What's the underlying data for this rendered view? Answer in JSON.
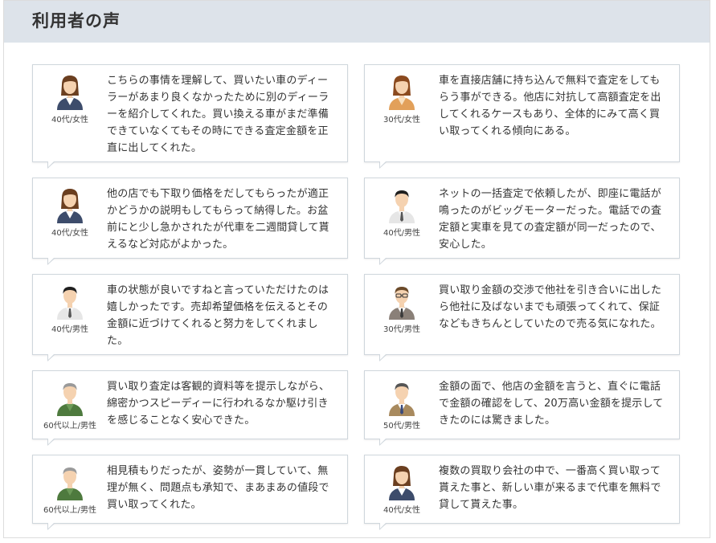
{
  "section": {
    "title": "利用者の声"
  },
  "testimonials": [
    {
      "age": "40代/女性",
      "avatar": "woman-business",
      "text": "こちらの事情を理解して、買いたい車のディーラーがあまり良くなかったために別のディーラーを紹介してくれた。買い換える車がまだ準備できていなくてもその時にできる査定金額を正直に出してくれた。"
    },
    {
      "age": "30代/女性",
      "avatar": "woman-orange",
      "text": "車を直接店舗に持ち込んで無料で査定をしてもらう事ができる。他店に対抗して高額査定を出してくれるケースもあり、全体的にみて高く買い取ってくれる傾向にある。"
    },
    {
      "age": "40代/女性",
      "avatar": "woman-business",
      "text": "他の店でも下取り価格をだしてもらったが適正かどうかの説明もしてもらって納得した。お盆前にと少し急かされたが代車を二週間貸して貰えるなど対応がよかった。"
    },
    {
      "age": "40代/男性",
      "avatar": "man-shirt",
      "text": "ネットの一括査定で依頼したが、即座に電話が鳴ったのがビッグモーターだった。電話での査定額と実車を見ての査定額が同一だったので、安心した。"
    },
    {
      "age": "40代/男性",
      "avatar": "man-shirt",
      "text": "車の状態が良いですねと言っていただけたのは嬉しかったです。売却希望価格を伝えるとその金額に近づけてくれると努力をしてくれました。"
    },
    {
      "age": "30代/男性",
      "avatar": "man-glasses",
      "text": "買い取り金額の交渉で他社を引き合いに出したら他社に及ばないまでも頑張ってくれて、保証などもきちんとしていたので売る気になれた。"
    },
    {
      "age": "60代以上/男性",
      "avatar": "man-senior",
      "text": "買い取り査定は客観的資料等を提示しながら、綿密かつスピーディーに行われるなか駆け引きを感じることなく安心できた。"
    },
    {
      "age": "50代/男性",
      "avatar": "man-gray",
      "text": "金額の面で、他店の金額を言うと、直ぐに電話で金額の確認をして、20万高い金額を提示してきたのには驚きました。"
    },
    {
      "age": "60代以上/男性",
      "avatar": "man-senior",
      "text": "相見積もりだったが、姿勢が一貫していて、無理が無く、問題点も承知で、まあまあの値段で買い取ってくれた。"
    },
    {
      "age": "40代/女性",
      "avatar": "woman-business",
      "text": "複数の買取り会社の中で、一番高く買い取って貰えた事と、新しい車が来るまで代車を無料で貸して貰えた事。"
    }
  ],
  "colors": {
    "header_bg": "#dde3ea",
    "card_border": "#cfd6dc",
    "text": "#333333"
  }
}
